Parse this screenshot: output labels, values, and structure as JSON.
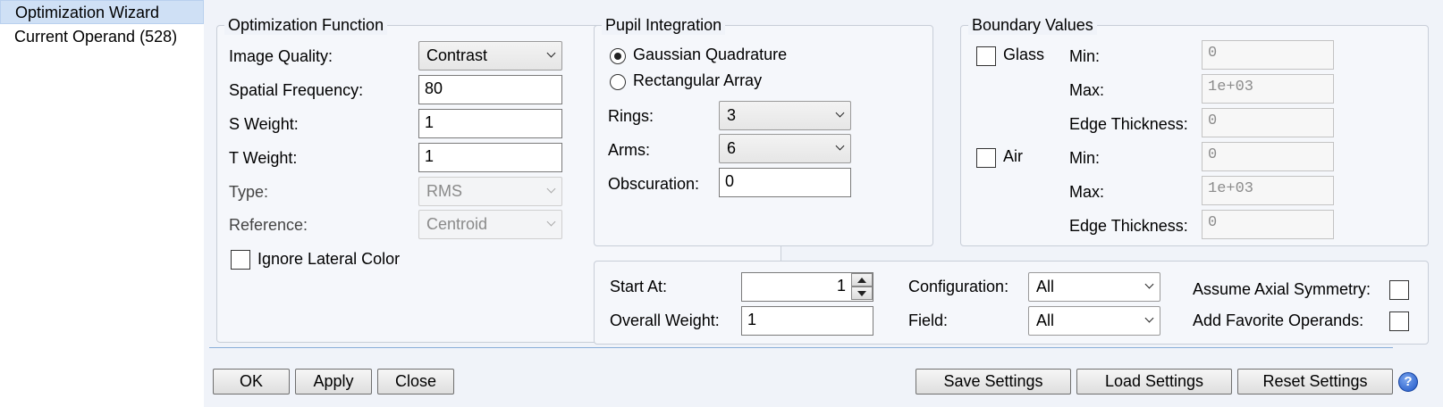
{
  "sidebar": {
    "items": [
      {
        "label": "Optimization Wizard",
        "selected": true
      },
      {
        "label": "Current Operand (528)",
        "selected": false
      }
    ]
  },
  "optimization_function": {
    "title": "Optimization Function",
    "image_quality": {
      "label": "Image Quality:",
      "value": "Contrast"
    },
    "spatial_frequency": {
      "label": "Spatial Frequency:",
      "value": "80"
    },
    "s_weight": {
      "label": "S Weight:",
      "value": "1"
    },
    "t_weight": {
      "label": "T Weight:",
      "value": "1"
    },
    "type": {
      "label": "Type:",
      "value": "RMS"
    },
    "reference": {
      "label": "Reference:",
      "value": "Centroid"
    },
    "ignore_lateral_color": {
      "label": "Ignore Lateral Color",
      "checked": false
    }
  },
  "pupil_integration": {
    "title": "Pupil Integration",
    "gaussian_quadrature": {
      "label": "Gaussian Quadrature",
      "selected": true
    },
    "rectangular_array": {
      "label": "Rectangular Array",
      "selected": false
    },
    "rings": {
      "label": "Rings:",
      "value": "3"
    },
    "arms": {
      "label": "Arms:",
      "value": "6"
    },
    "obscuration": {
      "label": "Obscuration:",
      "value": "0"
    }
  },
  "boundary_values": {
    "title": "Boundary Values",
    "glass": {
      "label": "Glass",
      "checked": false,
      "min_label": "Min:",
      "min": "0",
      "max_label": "Max:",
      "max": "1e+03",
      "edge_label": "Edge Thickness:",
      "edge": "0"
    },
    "air": {
      "label": "Air",
      "checked": false,
      "min_label": "Min:",
      "min": "0",
      "max_label": "Max:",
      "max": "1e+03",
      "edge_label": "Edge Thickness:",
      "edge": "0"
    }
  },
  "general": {
    "start_at": {
      "label": "Start At:",
      "value": "1"
    },
    "overall_weight": {
      "label": "Overall Weight:",
      "value": "1"
    },
    "configuration": {
      "label": "Configuration:",
      "value": "All"
    },
    "field": {
      "label": "Field:",
      "value": "All"
    },
    "assume_axial_symmetry": {
      "label": "Assume Axial Symmetry:",
      "checked": false
    },
    "add_favorite_operands": {
      "label": "Add Favorite Operands:",
      "checked": false
    }
  },
  "buttons": {
    "ok": "OK",
    "apply": "Apply",
    "close": "Close",
    "save_settings": "Save Settings",
    "load_settings": "Load Settings",
    "reset_settings": "Reset Settings",
    "help_glyph": "?"
  },
  "icons": {
    "help": "help-icon",
    "spin_up": "spin-up-icon",
    "spin_down": "spin-down-icon",
    "dropdown": "chevron-down-icon"
  },
  "colors": {
    "selection": "#cfe0f5",
    "panel": "#f0f3f9",
    "divider": "#8aaed8",
    "help": "#1f56c7"
  }
}
